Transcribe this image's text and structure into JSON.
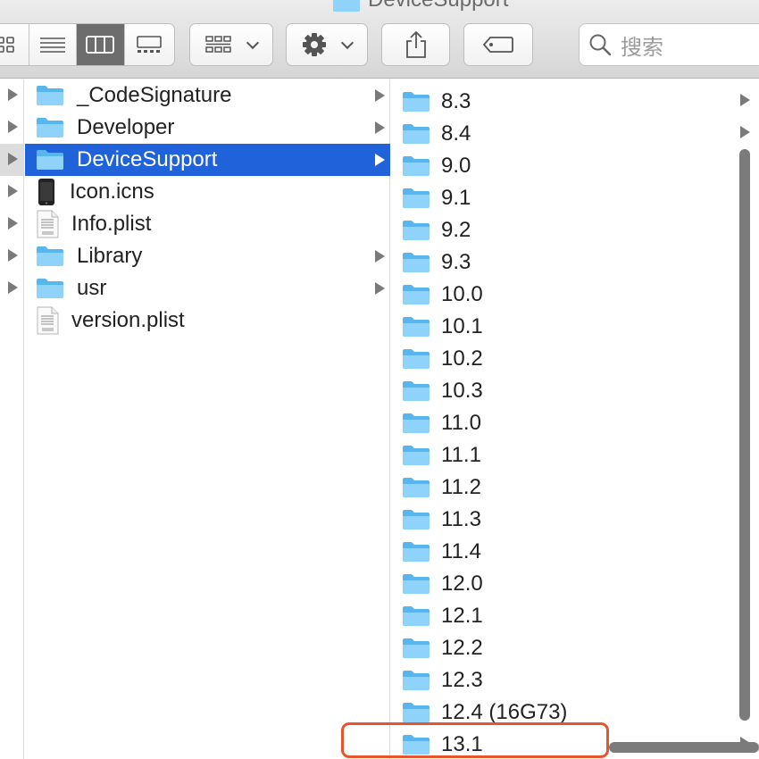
{
  "window": {
    "title": "DeviceSupport"
  },
  "toolbar": {
    "view_buttons": [
      "icon-view",
      "list-view",
      "column-view",
      "gallery-view"
    ],
    "active_view": "column-view",
    "group_button": "group-by",
    "action_button": "gear",
    "share_button": "share",
    "tags_button": "tags",
    "search_placeholder": "搜索"
  },
  "column1": {
    "rows_with_arrow": 7
  },
  "column2": {
    "items": [
      {
        "label": "_CodeSignature",
        "icon": "folder-icon",
        "has_children": true
      },
      {
        "label": "Developer",
        "icon": "folder-icon",
        "has_children": true
      },
      {
        "label": "DeviceSupport",
        "icon": "folder-icon",
        "has_children": true,
        "selected": true
      },
      {
        "label": "Icon.icns",
        "icon": "iphone-icon",
        "has_children": false
      },
      {
        "label": "Info.plist",
        "icon": "plist-document-icon",
        "has_children": false
      },
      {
        "label": "Library",
        "icon": "folder-icon",
        "has_children": true
      },
      {
        "label": "usr",
        "icon": "folder-icon",
        "has_children": true
      },
      {
        "label": "version.plist",
        "icon": "plist-document-icon",
        "has_children": false
      }
    ]
  },
  "column3": {
    "items": [
      {
        "label": "8.3"
      },
      {
        "label": "8.4"
      },
      {
        "label": "9.0"
      },
      {
        "label": "9.1"
      },
      {
        "label": "9.2"
      },
      {
        "label": "9.3"
      },
      {
        "label": "10.0"
      },
      {
        "label": "10.1"
      },
      {
        "label": "10.2"
      },
      {
        "label": "10.3"
      },
      {
        "label": "11.0"
      },
      {
        "label": "11.1"
      },
      {
        "label": "11.2"
      },
      {
        "label": "11.3"
      },
      {
        "label": "11.4"
      },
      {
        "label": "12.0"
      },
      {
        "label": "12.1"
      },
      {
        "label": "12.2"
      },
      {
        "label": "12.3"
      },
      {
        "label": "12.4 (16G73)"
      },
      {
        "label": "13.1",
        "highlighted": true
      }
    ]
  },
  "colors": {
    "selection": "#1f62d9",
    "folder": "#6cc4f5",
    "highlight_box": "#e8542b"
  }
}
